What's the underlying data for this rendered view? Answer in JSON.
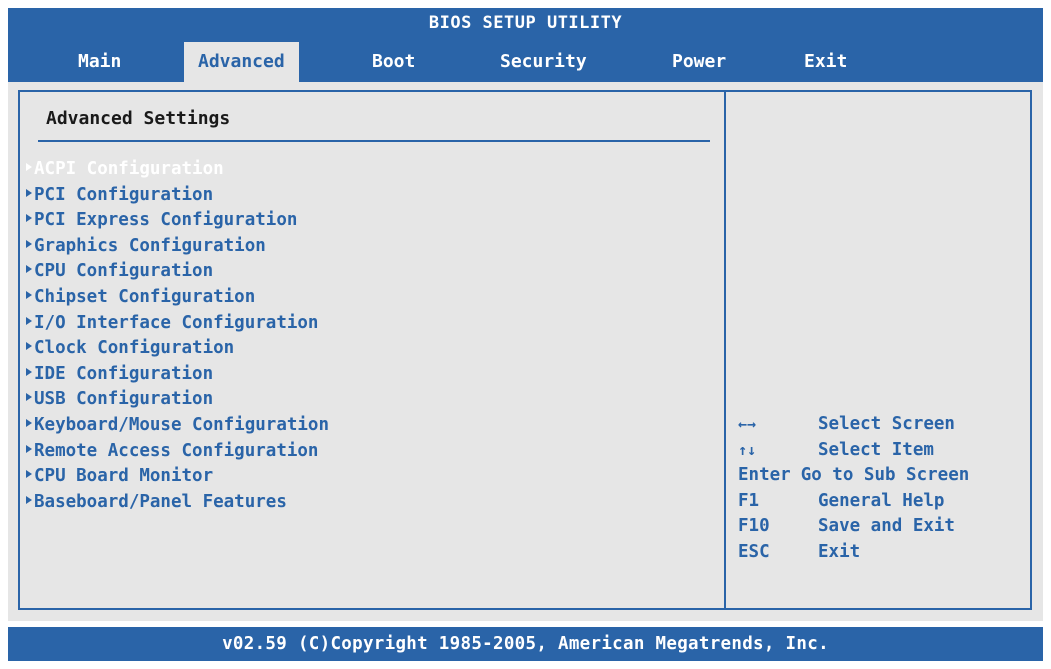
{
  "title": "BIOS SETUP UTILITY",
  "tabs": [
    {
      "label": "Main"
    },
    {
      "label": "Advanced"
    },
    {
      "label": "Boot"
    },
    {
      "label": "Security"
    },
    {
      "label": "Power"
    },
    {
      "label": "Exit"
    }
  ],
  "active_tab": "Advanced",
  "section_title": "Advanced Settings",
  "menu_items": [
    {
      "label": "ACPI Configuration",
      "selected": true
    },
    {
      "label": "PCI Configuration"
    },
    {
      "label": "PCI Express Configuration"
    },
    {
      "label": "Graphics Configuration"
    },
    {
      "label": "CPU Configuration"
    },
    {
      "label": "Chipset Configuration"
    },
    {
      "label": "I/O Interface Configuration"
    },
    {
      "label": "Clock Configuration"
    },
    {
      "label": "IDE Configuration"
    },
    {
      "label": "USB Configuration"
    },
    {
      "label": "Keyboard/Mouse Configuration"
    },
    {
      "label": "Remote Access Configuration"
    },
    {
      "label": "CPU Board Monitor"
    },
    {
      "label": "Baseboard/Panel Features"
    }
  ],
  "help": [
    {
      "key": "←→",
      "desc": "Select Screen"
    },
    {
      "key": "↑↓",
      "desc": "Select Item"
    },
    {
      "key": "Enter",
      "desc": "Go to Sub Screen"
    },
    {
      "key": "F1",
      "desc": "General Help"
    },
    {
      "key": "F10",
      "desc": "Save and Exit"
    },
    {
      "key": "ESC",
      "desc": "Exit"
    }
  ],
  "footer": "v02.59 (C)Copyright 1985-2005, American Megatrends, Inc.",
  "colors": {
    "bios_blue": "#2a64a8",
    "panel_grey": "#e6e6e6",
    "selected_text": "#ffffff"
  }
}
